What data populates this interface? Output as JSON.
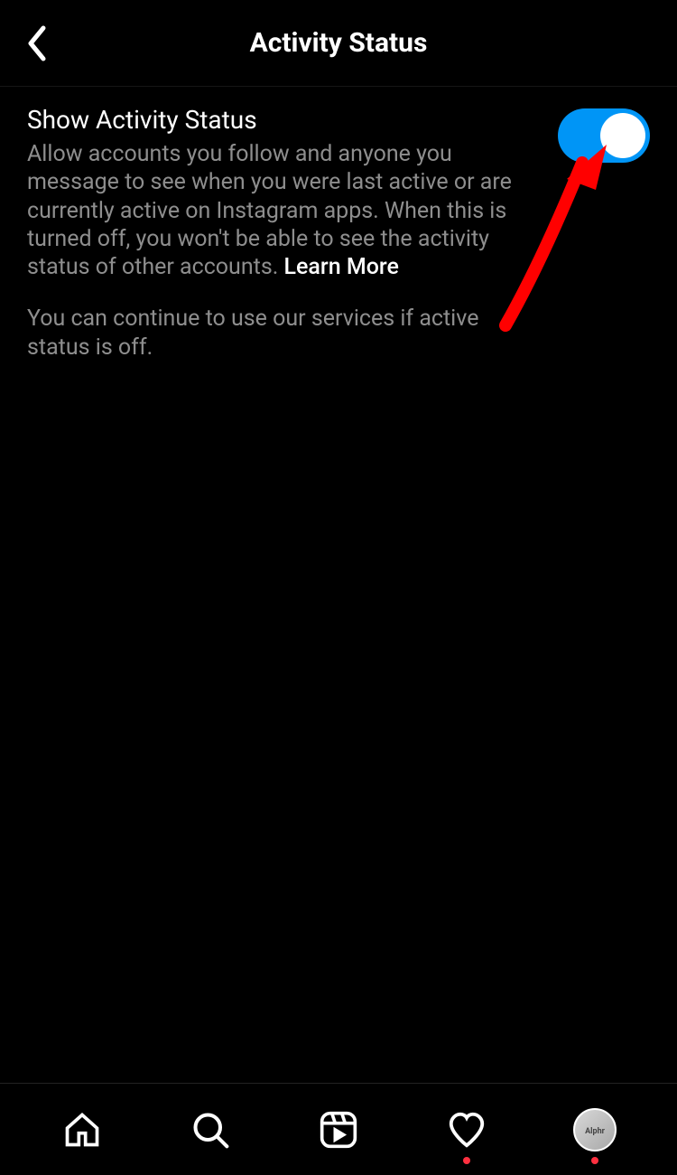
{
  "header": {
    "title": "Activity Status"
  },
  "setting": {
    "title": "Show Activity Status",
    "description": "Allow accounts you follow and anyone you message to see when you were last active or are currently active on Instagram apps. When this is turned off, you won't be able to see the activity status of other accounts. ",
    "learn_more": "Learn More",
    "footer": "You can continue to use our services if active status is off.",
    "toggle_on": true
  },
  "colors": {
    "accent": "#0095f6",
    "annotation": "#ff0000"
  }
}
